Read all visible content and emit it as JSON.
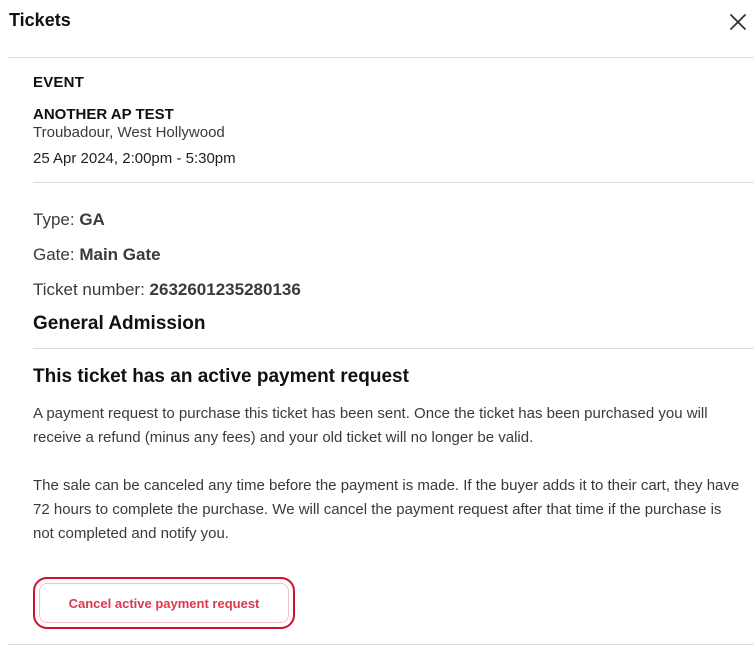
{
  "header": {
    "title": "Tickets",
    "close_icon": "close-icon"
  },
  "event": {
    "section_label": "EVENT",
    "name": "ANOTHER AP TEST",
    "venue": "Troubadour, West Hollywood",
    "datetime": "25 Apr 2024, 2:00pm - 5:30pm"
  },
  "ticket": {
    "type_label": "Type:",
    "type_value": "GA",
    "gate_label": "Gate:",
    "gate_value": "Main Gate",
    "number_label": "Ticket number:",
    "number_value": "2632601235280136",
    "admission": "General Admission"
  },
  "payment_request": {
    "title": "This ticket has an active payment request",
    "paragraph1": "A payment request to purchase this ticket has been sent. Once the ticket has been purchased you will receive a refund (minus any fees) and your old ticket will no longer be valid.",
    "paragraph2": "The sale can be canceled any time before the payment is made. If the buyer adds it to their cart, they have 72 hours to complete the purchase. We will cancel the payment request after that time if the purchase is not completed and notify you.",
    "cancel_label": "Cancel active payment request"
  },
  "colors": {
    "accent_red": "#d0102f",
    "button_text": "#d83a4e"
  }
}
